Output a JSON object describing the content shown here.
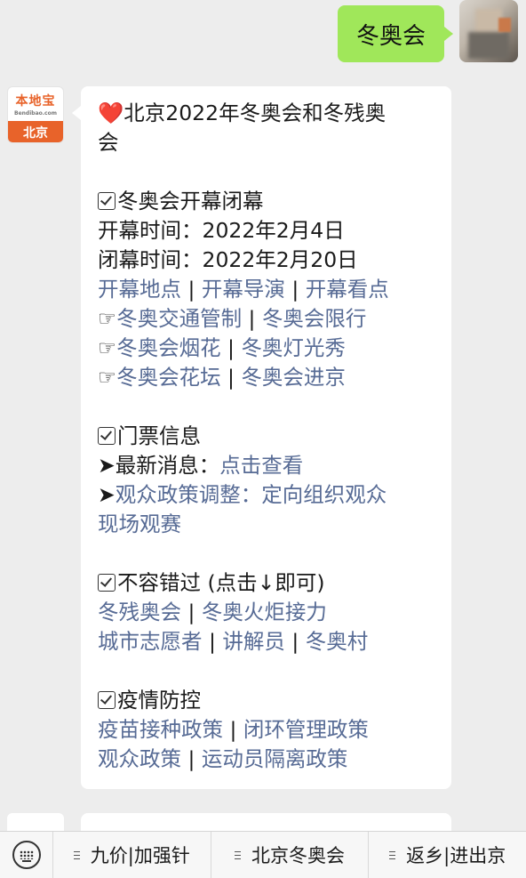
{
  "outgoing_message": {
    "text": "冬奥会"
  },
  "account": {
    "logo_name": "本地宝",
    "logo_sub": "Bendibao.com",
    "logo_city": "北京"
  },
  "message": {
    "title_line1": "北京2022年冬奥会和冬残奥",
    "title_line2": "会",
    "sec1": {
      "heading": "冬奥会开幕闭幕",
      "open_time": "开幕时间：2022年2月4日",
      "close_time": "闭幕时间：2022年2月20日",
      "links_row1": [
        "开幕地点",
        "开幕导演",
        "开幕看点"
      ],
      "links_row2": [
        "冬奥交通管制",
        "冬奥会限行"
      ],
      "links_row3": [
        "冬奥会烟花",
        "冬奥灯光秀"
      ],
      "links_row4": [
        "冬奥会花坛",
        "冬奥会进京"
      ]
    },
    "sec2": {
      "heading": "门票信息",
      "news_label": "最新消息：",
      "news_link": "点击查看",
      "policy_link_line1": "观众政策调整：定向组织观众",
      "policy_link_line2": "现场观赛"
    },
    "sec3": {
      "heading": "不容错过 (点击↓即可)",
      "links_row1": [
        "冬残奥会",
        "冬奥火炬接力"
      ],
      "links_row2": [
        "城市志愿者",
        "讲解员",
        "冬奥村"
      ]
    },
    "sec4": {
      "heading": "疫情防控",
      "links_row1": [
        "疫苗接种政策",
        "闭环管理政策"
      ],
      "links_row2": [
        "观众政策",
        "运动员隔离政策"
      ]
    },
    "pointer_glyph": "☞",
    "arrow_glyph": "➤",
    "separator": " | "
  },
  "menu": {
    "items": [
      "九价|加强针",
      "北京冬奥会",
      "返乡|进出京"
    ]
  },
  "colors": {
    "link": "#576b95",
    "outgoing_bubble": "#a0e75a",
    "brand": "#e8632a"
  }
}
